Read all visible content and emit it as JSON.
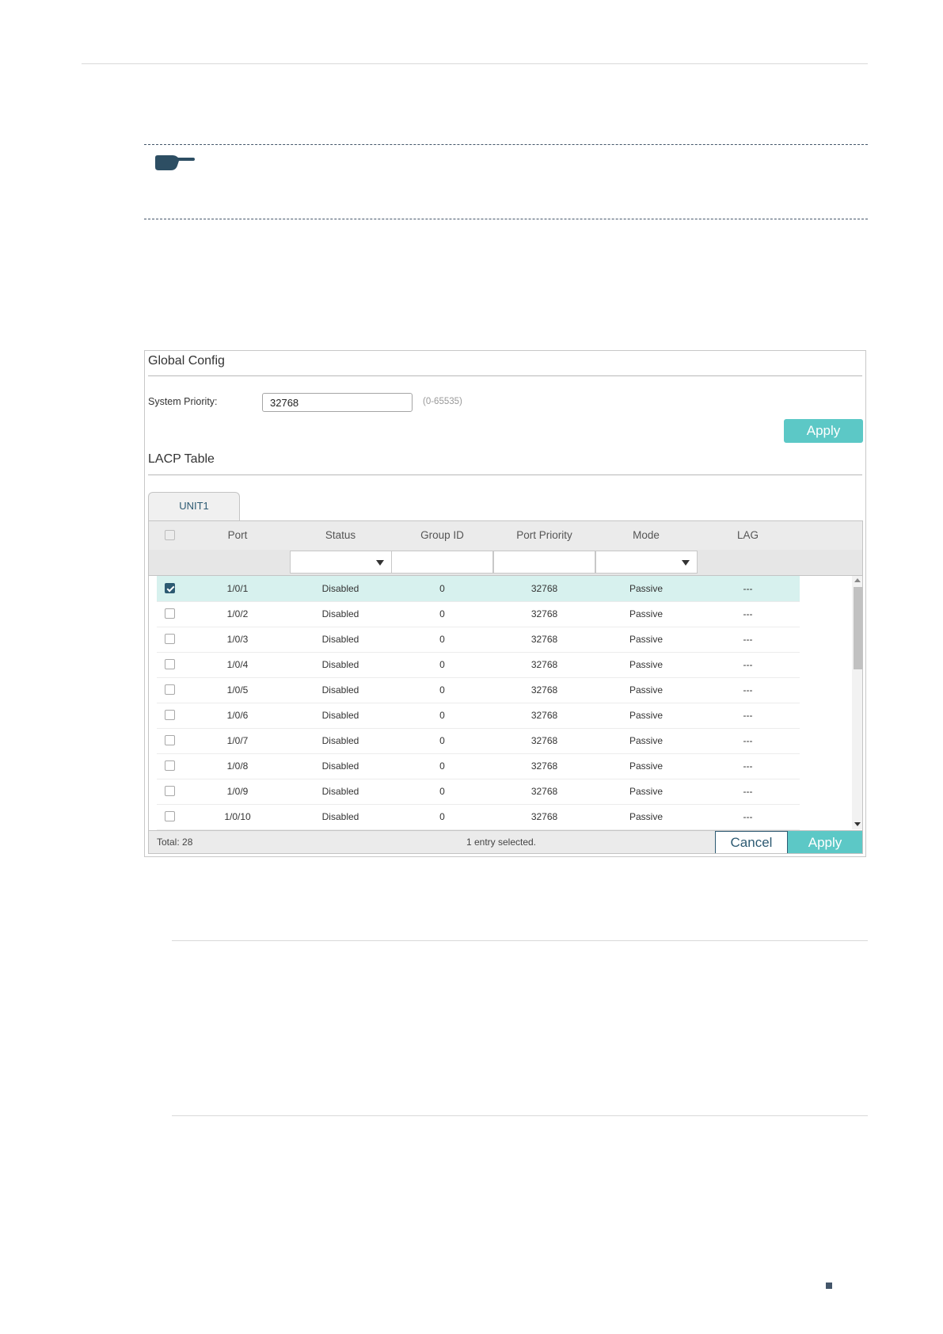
{
  "global_config": {
    "title": "Global Config",
    "system_priority_label": "System Priority:",
    "system_priority_value": "32768",
    "system_priority_hint": "(0-65535)",
    "apply_label": "Apply"
  },
  "lacp_table": {
    "title": "LACP Table",
    "tab_label": "UNIT1",
    "columns": [
      "Port",
      "Status",
      "Group ID",
      "Port Priority",
      "Mode",
      "LAG"
    ],
    "rows": [
      {
        "checked": true,
        "port": "1/0/1",
        "status": "Disabled",
        "group_id": "0",
        "port_priority": "32768",
        "mode": "Passive",
        "lag": "---"
      },
      {
        "checked": false,
        "port": "1/0/2",
        "status": "Disabled",
        "group_id": "0",
        "port_priority": "32768",
        "mode": "Passive",
        "lag": "---"
      },
      {
        "checked": false,
        "port": "1/0/3",
        "status": "Disabled",
        "group_id": "0",
        "port_priority": "32768",
        "mode": "Passive",
        "lag": "---"
      },
      {
        "checked": false,
        "port": "1/0/4",
        "status": "Disabled",
        "group_id": "0",
        "port_priority": "32768",
        "mode": "Passive",
        "lag": "---"
      },
      {
        "checked": false,
        "port": "1/0/5",
        "status": "Disabled",
        "group_id": "0",
        "port_priority": "32768",
        "mode": "Passive",
        "lag": "---"
      },
      {
        "checked": false,
        "port": "1/0/6",
        "status": "Disabled",
        "group_id": "0",
        "port_priority": "32768",
        "mode": "Passive",
        "lag": "---"
      },
      {
        "checked": false,
        "port": "1/0/7",
        "status": "Disabled",
        "group_id": "0",
        "port_priority": "32768",
        "mode": "Passive",
        "lag": "---"
      },
      {
        "checked": false,
        "port": "1/0/8",
        "status": "Disabled",
        "group_id": "0",
        "port_priority": "32768",
        "mode": "Passive",
        "lag": "---"
      },
      {
        "checked": false,
        "port": "1/0/9",
        "status": "Disabled",
        "group_id": "0",
        "port_priority": "32768",
        "mode": "Passive",
        "lag": "---"
      },
      {
        "checked": false,
        "port": "1/0/10",
        "status": "Disabled",
        "group_id": "0",
        "port_priority": "32768",
        "mode": "Passive",
        "lag": "---"
      }
    ],
    "footer": {
      "total": "Total: 28",
      "selection": "1 entry selected.",
      "cancel_label": "Cancel",
      "apply_label": "Apply"
    }
  },
  "icons": {
    "note": "pointing-hand-icon",
    "dropdown": "caret-down-icon",
    "page_marker": "square-bullet-icon"
  },
  "colors": {
    "accent": "#5cc8c6",
    "primary": "#2d5a72",
    "selected_row": "#d7f1ee",
    "note_icon": "#44566a"
  }
}
